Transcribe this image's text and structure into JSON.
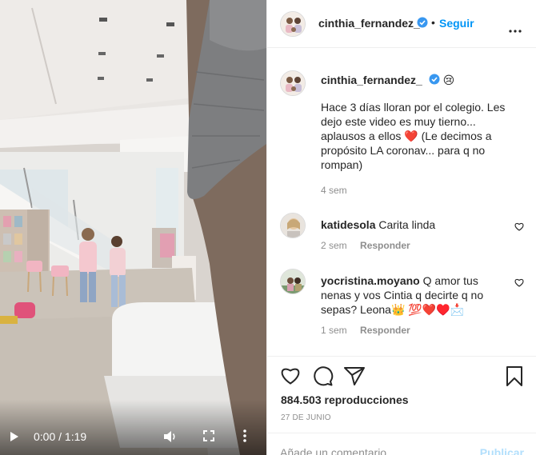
{
  "video": {
    "current_time": "0:00",
    "separator": "/",
    "duration": "1:19",
    "progress": 0.0
  },
  "header": {
    "username": "cinthia_fernandez_",
    "separator": "•",
    "follow_label": "Seguir"
  },
  "caption": {
    "username": "cinthia_fernandez_",
    "emoji": "😢",
    "text": "Hace 3 días lloran por el colegio. Les dejo este video es muy tierno... aplausos a ellos ❤️ (Le decimos a propósito LA coronav... para q no rompan)",
    "time": "4 sem"
  },
  "comments": [
    {
      "username": "katidesola",
      "text": "Carita linda",
      "time": "2 sem",
      "reply_label": "Responder"
    },
    {
      "username": "yocristina.moyano",
      "text": "Q amor tus nenas y vos Cintia q decirte q no sepas? Leona👑 💯❤️♥️📩",
      "time": "1 sem",
      "reply_label": "Responder"
    }
  ],
  "stats": {
    "views": "884.503 reproducciones",
    "date": "27 DE JUNIO"
  },
  "add_comment": {
    "placeholder": "Añade un comentario...",
    "publish_label": "Publicar"
  },
  "colors": {
    "link_blue": "#0095f6",
    "publish_disabled": "#b2dffc",
    "verified": "#3897f0",
    "muted": "#8e8e8e"
  }
}
